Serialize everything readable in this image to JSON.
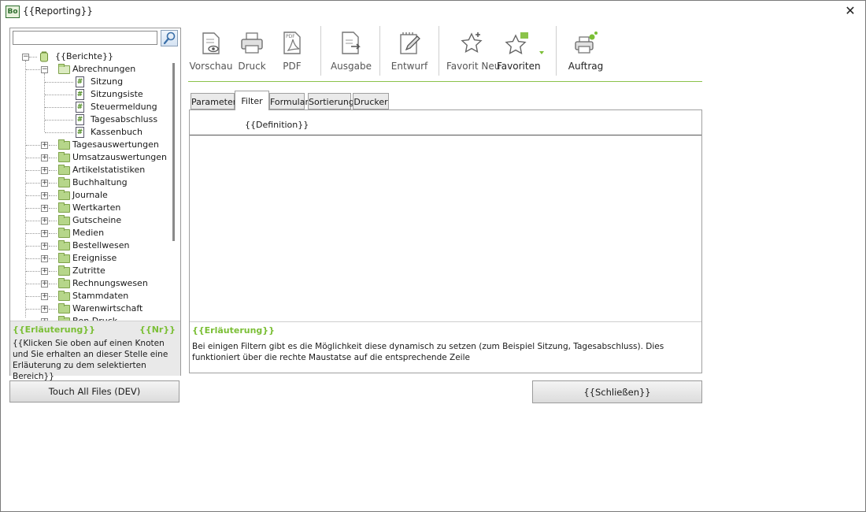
{
  "window": {
    "title": "{{Reporting}}",
    "app_icon_text": "Bo",
    "close_symbol": "✕"
  },
  "search": {
    "value": "",
    "placeholder": ""
  },
  "tree": {
    "root": "{{Berichte}}",
    "open_folder": "Abrechnungen",
    "reports": [
      "Sitzung",
      "Sitzungsiste",
      "Steuermeldung",
      "Tagesabschluss",
      "Kassenbuch"
    ],
    "folders": [
      "Tagesauswertungen",
      "Umsatzauswertungen",
      "Artikelstatistiken",
      "Buchhaltung",
      "Journale",
      "Wertkarten",
      "Gutscheine",
      "Medien",
      "Bestellwesen",
      "Ereignisse",
      "Zutritte",
      "Rechnungswesen",
      "Stammdaten",
      "Warenwirtschaft",
      "Bon Druck"
    ]
  },
  "info": {
    "title": "{{Erläuterung}}",
    "nr": "{{Nr}}",
    "text": "{{Klicken Sie oben auf einen Knoten und Sie erhalten an dieser Stelle eine Erläuterung zu dem selektierten Bereich}}"
  },
  "touch_button": "Touch All Files (DEV)",
  "toolbar": {
    "vorschau": "Vorschau",
    "druck": "Druck",
    "pdf": "PDF",
    "ausgabe": "Ausgabe",
    "entwurf": "Entwurf",
    "favorit_neu": "Favorit Neu",
    "favoriten": "Favoriten",
    "auftrag": "Auftrag"
  },
  "tabs": [
    "Parameter",
    "Filter",
    "Formular",
    "Sortierung",
    "Drucker"
  ],
  "active_tab": "Filter",
  "definition_label": "{{Definition}}",
  "description": {
    "title": "{{Erläuterung}}",
    "text": "Bei einigen Filtern gibt es die Möglichkeit diese dynamisch zu setzen (zum Beispiel Sitzung, Tagesabschluss). Dies funktioniert über die rechte Maustatse auf die entsprechende Zeile"
  },
  "close_button": "{{Schließen}}",
  "colors": {
    "accent_green": "#7bbf36",
    "folder_green": "#b6d68a"
  }
}
